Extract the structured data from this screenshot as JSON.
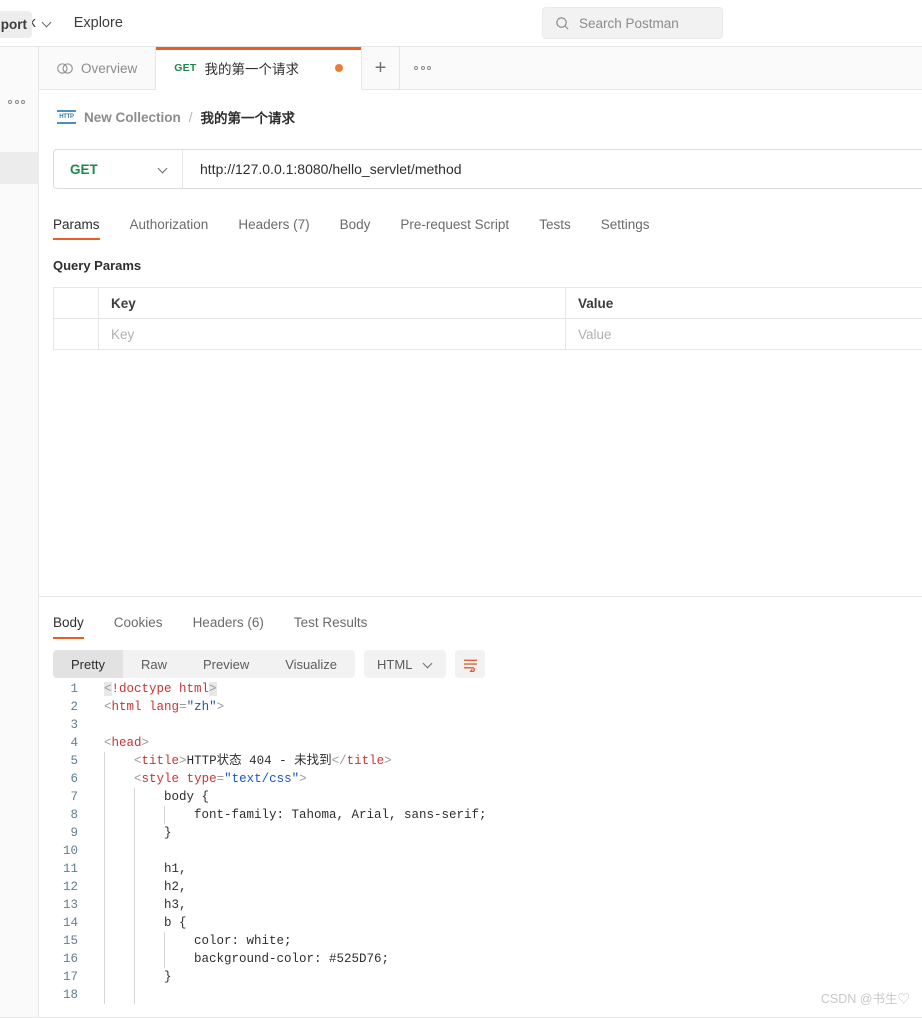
{
  "header": {
    "nav": [
      {
        "label": "etwork",
        "icon": "chevron-down-icon"
      },
      {
        "label": "Explore",
        "icon": ""
      }
    ],
    "search": {
      "placeholder": "Search Postman",
      "icon": "search-icon"
    }
  },
  "rail": {
    "import_label": "port",
    "more_icon": "more-horizontal-icon"
  },
  "tabs": [
    {
      "label": "Overview",
      "icon": "overview-icon",
      "active": false
    },
    {
      "method": "GET",
      "label": "我的第一个请求",
      "active": true,
      "unsaved": true
    }
  ],
  "tab_actions": {
    "new_tab": "+",
    "more": "more-horizontal-icon"
  },
  "breadcrumb": {
    "icon": "http-icon",
    "collection": "New Collection",
    "separator": "/",
    "request": "我的第一个请求"
  },
  "request": {
    "method": "GET",
    "method_caret": "chevron-down-icon",
    "url": "http://127.0.0.1:8080/hello_servlet/method"
  },
  "request_tabs": [
    {
      "label": "Params",
      "active": true
    },
    {
      "label": "Authorization",
      "active": false
    },
    {
      "label": "Headers (7)",
      "active": false
    },
    {
      "label": "Body",
      "active": false
    },
    {
      "label": "Pre-request Script",
      "active": false
    },
    {
      "label": "Tests",
      "active": false
    },
    {
      "label": "Settings",
      "active": false
    }
  ],
  "query_params": {
    "title": "Query Params",
    "columns": [
      "Key",
      "Value"
    ],
    "rows": [
      {
        "key_placeholder": "Key",
        "value_placeholder": "Value"
      }
    ]
  },
  "response_tabs": [
    {
      "label": "Body",
      "active": true
    },
    {
      "label": "Cookies",
      "active": false
    },
    {
      "label": "Headers (6)",
      "active": false
    },
    {
      "label": "Test Results",
      "active": false
    }
  ],
  "view_modes": [
    {
      "label": "Pretty",
      "active": true
    },
    {
      "label": "Raw",
      "active": false
    },
    {
      "label": "Preview",
      "active": false
    },
    {
      "label": "Visualize",
      "active": false
    }
  ],
  "format": {
    "label": "HTML",
    "caret": "chevron-down-icon"
  },
  "wrap_button": {
    "icon": "wrap-text-icon"
  },
  "code_lines": [
    {
      "n": "1",
      "text": "<!doctype html>"
    },
    {
      "n": "2",
      "text": "<html lang=\"zh\">"
    },
    {
      "n": "3",
      "text": ""
    },
    {
      "n": "4",
      "text": "<head>"
    },
    {
      "n": "5",
      "text": "    <title>HTTP状态 404 - 未找到</title>"
    },
    {
      "n": "6",
      "text": "    <style type=\"text/css\">"
    },
    {
      "n": "7",
      "text": "        body {"
    },
    {
      "n": "8",
      "text": "            font-family: Tahoma, Arial, sans-serif;"
    },
    {
      "n": "9",
      "text": "        }"
    },
    {
      "n": "10",
      "text": ""
    },
    {
      "n": "11",
      "text": "        h1,"
    },
    {
      "n": "12",
      "text": "        h2,"
    },
    {
      "n": "13",
      "text": "        h3,"
    },
    {
      "n": "14",
      "text": "        b {"
    },
    {
      "n": "15",
      "text": "            color: white;"
    },
    {
      "n": "16",
      "text": "            background-color: #525D76;"
    },
    {
      "n": "17",
      "text": "        }"
    },
    {
      "n": "18",
      "text": ""
    }
  ],
  "watermark": "CSDN @书生♡",
  "colors": {
    "accent_orange": "#ef5b25",
    "method_green": "#1d8a4c",
    "unsaved_dot": "#ef7c34",
    "line_number": "#5f7f95",
    "code_tag": "#cc3333",
    "code_value": "#1a56c4"
  }
}
